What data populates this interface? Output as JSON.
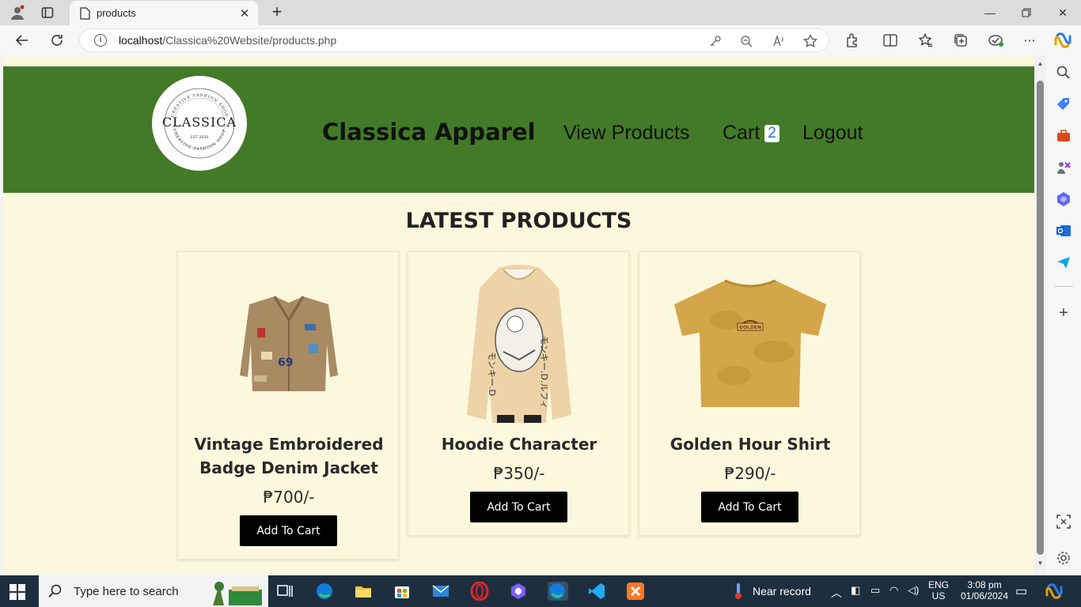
{
  "browser": {
    "tab_title": "products",
    "url_host": "localhost",
    "url_path": "/Classica%20Website/products.php"
  },
  "site": {
    "brand": "Classica Apparel",
    "logo": {
      "name": "CLASSICA",
      "est": "EST. 2020",
      "ring_text": "CREATIVE FASHION SHOP"
    },
    "nav": {
      "view_products": "View Products",
      "cart": "Cart",
      "cart_count": "2",
      "logout": "Logout"
    },
    "section_title": "LATEST PRODUCTS",
    "add_to_cart_label": "Add To Cart",
    "products": [
      {
        "name_line1": "Vintage Embroidered",
        "name_line2": "Badge Denim Jacket",
        "price": "₱700/-"
      },
      {
        "name_line1": "Hoodie Character",
        "price": "₱350/-"
      },
      {
        "name_line1": "Golden Hour Shirt",
        "price": "₱290/-"
      }
    ]
  },
  "taskbar": {
    "search_placeholder": "Type here to search",
    "weather": "Near record",
    "lang1": "ENG",
    "lang2": "US",
    "time": "3:08 pm",
    "date": "01/06/2024"
  },
  "colors": {
    "header_green": "#427a28",
    "page_bg": "#fbf8dd",
    "button_bg": "#000000"
  }
}
